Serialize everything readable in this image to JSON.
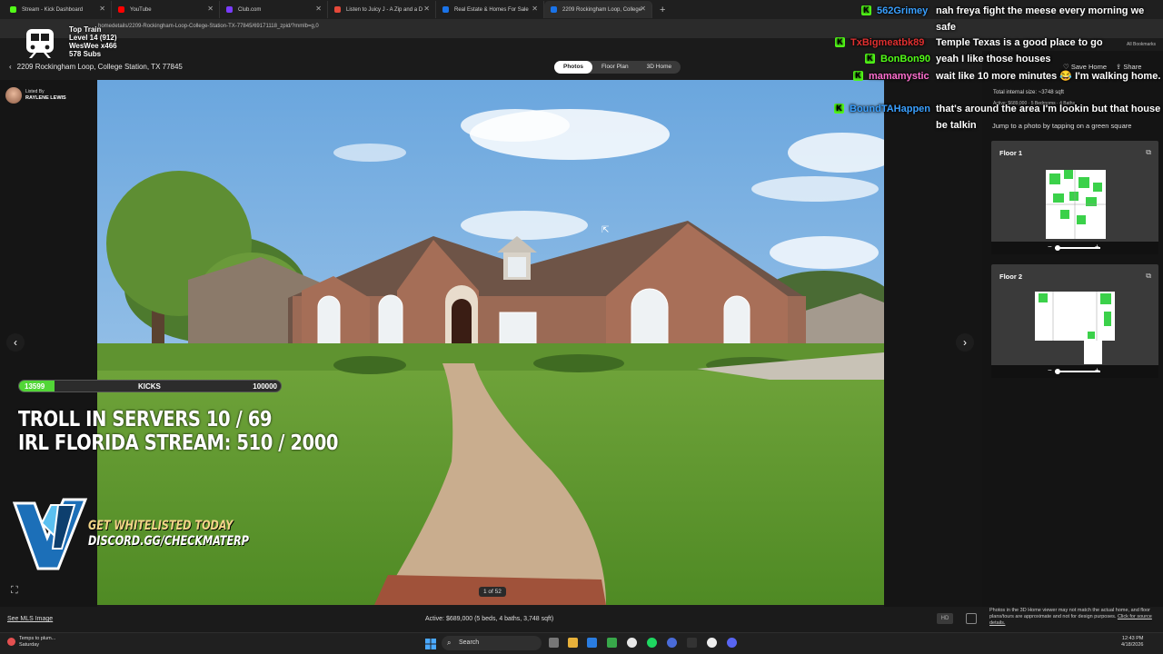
{
  "browser": {
    "tabs": [
      {
        "label": "Stream - Kick Dashboard",
        "color": "#53fc18"
      },
      {
        "label": "YouTube",
        "color": "#ff0000"
      },
      {
        "label": "Club.com",
        "color": "#7a3cff"
      },
      {
        "label": "Listen to Juicy J - A Zip and a D",
        "color": "#e5493a"
      },
      {
        "label": "Real Estate & Homes For Sale",
        "color": "#1a73e8"
      },
      {
        "label": "2209 Rockingham Loop, College",
        "color": "#1a73e8"
      }
    ],
    "url": "homedetails/2209-Rockingham-Loop-College-Station-TX-77845/69171118_zpid/?mmlb=g,0",
    "bookmarks_label": "All Bookmarks"
  },
  "listing": {
    "address": "2209 Rockingham Loop, College Station, TX 77845",
    "view_tabs": [
      "Photos",
      "Floor Plan",
      "3D Home"
    ],
    "listed_by_label": "Listed By",
    "agent_name": "RAYLENE LEWIS",
    "photo_counter": "1 of 52",
    "see_mls": "See MLS Image",
    "summary": "Active: $689,000 (5 beds, 4 baths, 3,748 sqft)",
    "hd_label": "HD",
    "save_label": "Save Home",
    "share_label": "Share",
    "internal_size": "Total internal size: ~3748 sqft",
    "active_info": "Active: $689,000 · 5 Bedrooms · 4 Baths",
    "jump_text": "Jump to a photo by tapping on a green square",
    "floors": [
      "Floor 1",
      "Floor 2"
    ],
    "disclaimer": "Photos in the 3D Home viewer may not match the actual home, and floor plans/tours are approximate and not for design purposes.",
    "source_link": "Click for source details."
  },
  "overlay": {
    "train_title": "Top Train",
    "train_level": "Level 14 (912)",
    "train_user": "WesWee x466",
    "train_subs": "578 Subs",
    "kicks_current": "13599",
    "kicks_label": "KICKS",
    "kicks_goal": "100000",
    "kicks_progress": 0.136,
    "goal_line1": "TROLL IN SERVERS  10 / 69",
    "goal_line2": "IRL FLORIDA STREAM:  510 / 2000",
    "whitelist_line1": "GET WHITELISTED TODAY",
    "whitelist_line2": "DISCORD.GG/CHECKMATERP"
  },
  "chat": [
    {
      "name": "562Grimey",
      "color": "#3aa0ff",
      "message": "nah freya fight the meese every morning we safe"
    },
    {
      "name": "TxBigmeatbk89",
      "color": "#e03030",
      "message": "Temple Texas is a good place to go"
    },
    {
      "name": "BonBon90",
      "color": "#53fc18",
      "message": "yeah I like those houses"
    },
    {
      "name": "mamamystic",
      "color": "#ff6fd0",
      "message": "wait like 10 more minutes 😂 I'm walking home."
    },
    {
      "name": "BoundTAHappen",
      "color": "#3aa0ff",
      "message": "that's around the area I'm lookin but that house be talkin"
    }
  ],
  "taskbar": {
    "weather_line1": "Temps to plum...",
    "weather_line2": "Saturday",
    "search_placeholder": "Search",
    "time": "12:43 PM",
    "date": "4/18/2026"
  }
}
